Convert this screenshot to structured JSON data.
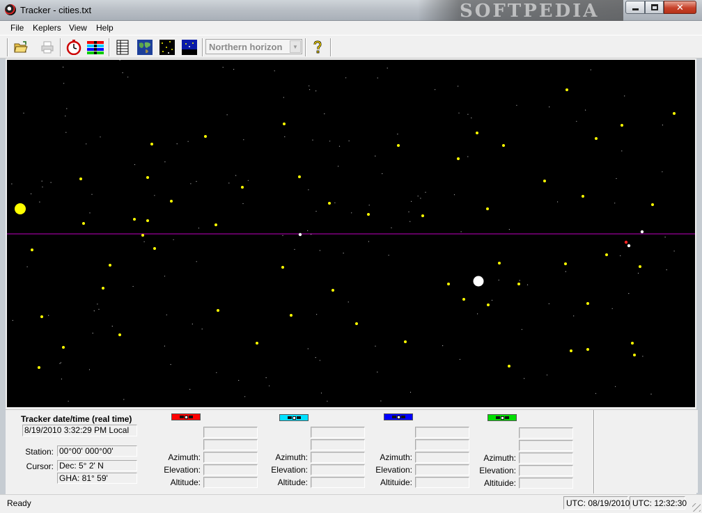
{
  "window": {
    "title": "Tracker - cities.txt",
    "watermark": "SOFTPEDIA"
  },
  "menu": [
    "File",
    "Keplers",
    "View",
    "Help"
  ],
  "toolbar": {
    "horizon_select": "Northern horizon",
    "icons": [
      "open-folder-icon",
      "print-icon",
      "stopwatch-icon",
      "color-bars-icon",
      "table-icon",
      "world-map-icon",
      "star-field-icon",
      "night-sky-icon",
      "help-icon"
    ]
  },
  "sky": {
    "background": "#000000",
    "star_color": "#ffff00",
    "horizon_color": "#c000c0"
  },
  "panel": {
    "title": "Tracker date/time (real time)",
    "datetime": "8/19/2010 3:32:29 PM Local",
    "station_label": "Station:",
    "station_value": "00°00'    000°00'",
    "cursor_label": "Cursor:",
    "cursor_dec": "Dec: 5° 2' N",
    "cursor_gha": "GHA: 81° 59'",
    "trackers": [
      {
        "color": "#ff0000",
        "azimuth_label": "Azimuth:",
        "elevation_label": "Elevation:",
        "altitude_label": "Altitude:"
      },
      {
        "color": "#00e0ff",
        "azimuth_label": "Azimuth:",
        "elevation_label": "Elevation:",
        "altitude_label": "Altitude:"
      },
      {
        "color": "#0000ff",
        "azimuth_label": "Azimuth:",
        "elevation_label": "Elevation:",
        "altitude_label": "Altituide:"
      },
      {
        "color": "#00dd00",
        "azimuth_label": "Azimuth:",
        "elevation_label": "Elevation:",
        "altitude_label": "Altituide:"
      }
    ]
  },
  "status": {
    "ready": "Ready",
    "utc_date": "UTC: 08/19/2010",
    "utc_time": "UTC: 12:32:30"
  }
}
